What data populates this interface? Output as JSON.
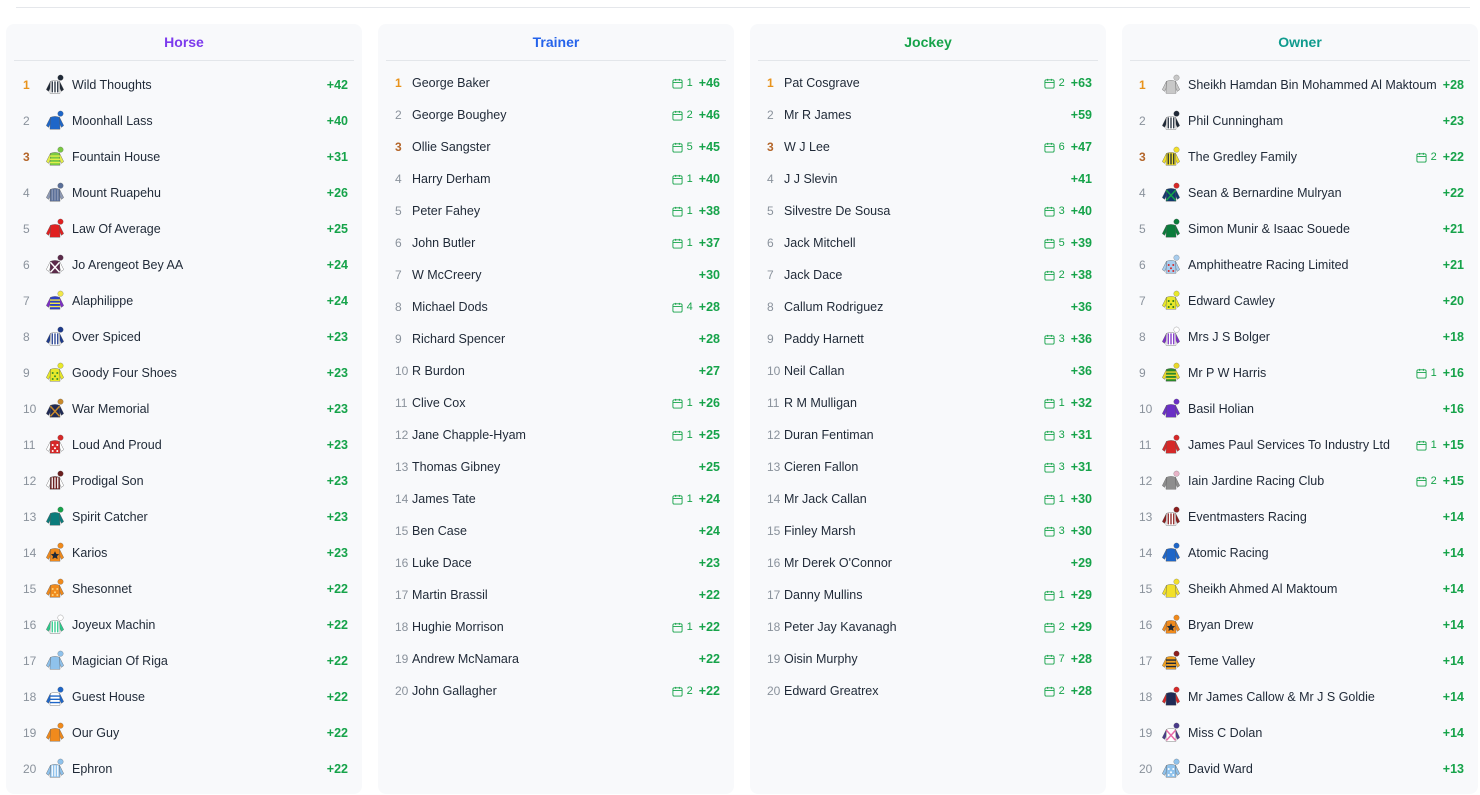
{
  "colors": {
    "horse": "#7c3aed",
    "trainer": "#2563eb",
    "jockey": "#16a34a",
    "owner": "#0f9b8e",
    "positive": "#16a34a",
    "gold": "#e8931c",
    "bronze": "#b4662a"
  },
  "panels": [
    {
      "title": "Horse",
      "rows": [
        {
          "rank": "1",
          "name": "Wild Thoughts",
          "cal": "",
          "score": "+42",
          "silk": {
            "body": "#ffffff",
            "sleeve": "#1f2937",
            "cap": "#1f2937",
            "pattern": "stripes",
            "pc": "#1f2937"
          }
        },
        {
          "rank": "2",
          "name": "Moonhall Lass",
          "cal": "",
          "score": "+40",
          "silk": {
            "body": "#1e66c8",
            "sleeve": "#1e66c8",
            "cap": "#1e66c8",
            "pattern": "none",
            "pc": "#ffffff"
          }
        },
        {
          "rank": "3",
          "name": "Fountain House",
          "cal": "",
          "score": "+31",
          "silk": {
            "body": "#7ac943",
            "sleeve": "#e2ef4a",
            "cap": "#7ac943",
            "pattern": "hoops",
            "pc": "#e2ef4a"
          }
        },
        {
          "rank": "4",
          "name": "Mount Ruapehu",
          "cal": "",
          "score": "+26",
          "silk": {
            "body": "#5a6f99",
            "sleeve": "#8e9ab5",
            "cap": "#5a6f99",
            "pattern": "stripes",
            "pc": "#8e9ab5"
          }
        },
        {
          "rank": "5",
          "name": "Law Of Average",
          "cal": "",
          "score": "+25",
          "silk": {
            "body": "#e02020",
            "sleeve": "#e02020",
            "cap": "#e02020",
            "pattern": "none",
            "pc": "#ffffff"
          }
        },
        {
          "rank": "6",
          "name": "Jo Arengeot Bey AA",
          "cal": "",
          "score": "+24",
          "silk": {
            "body": "#5b2a4a",
            "sleeve": "#ffffff",
            "cap": "#5b2a4a",
            "pattern": "cross",
            "pc": "#ffffff"
          }
        },
        {
          "rank": "7",
          "name": "Alaphilippe",
          "cal": "",
          "score": "+24",
          "silk": {
            "body": "#2b3ec7",
            "sleeve": "#7b2fc5",
            "cap": "#f2e84a",
            "pattern": "hoops",
            "pc": "#f2e84a"
          }
        },
        {
          "rank": "8",
          "name": "Over Spiced",
          "cal": "",
          "score": "+23",
          "silk": {
            "body": "#ffffff",
            "sleeve": "#1d3a8c",
            "cap": "#1d3a8c",
            "pattern": "stripes",
            "pc": "#1d3a8c"
          }
        },
        {
          "rank": "9",
          "name": "Goody Four Shoes",
          "cal": "",
          "score": "+23",
          "silk": {
            "body": "#e8e82a",
            "sleeve": "#e8e82a",
            "cap": "#e8e82a",
            "pattern": "dots",
            "pc": "#3a8f2a"
          }
        },
        {
          "rank": "10",
          "name": "War Memorial",
          "cal": "",
          "score": "+23",
          "silk": {
            "body": "#1f2a55",
            "sleeve": "#1f2a55",
            "cap": "#c98a2b",
            "pattern": "cross",
            "pc": "#c98a2b"
          }
        },
        {
          "rank": "11",
          "name": "Loud And Proud",
          "cal": "",
          "score": "+23",
          "silk": {
            "body": "#d62828",
            "sleeve": "#ffffff",
            "cap": "#d62828",
            "pattern": "dots",
            "pc": "#ffffff"
          }
        },
        {
          "rank": "12",
          "name": "Prodigal Son",
          "cal": "",
          "score": "+23",
          "silk": {
            "body": "#6b1f1f",
            "sleeve": "#ffffff",
            "cap": "#6b1f1f",
            "pattern": "stripes",
            "pc": "#ffffff"
          }
        },
        {
          "rank": "13",
          "name": "Spirit Catcher",
          "cal": "",
          "score": "+23",
          "silk": {
            "body": "#0b7b7b",
            "sleeve": "#0b7b7b",
            "cap": "#16a34a",
            "pattern": "none",
            "pc": "#ffffff"
          }
        },
        {
          "rank": "14",
          "name": "Karios",
          "cal": "",
          "score": "+23",
          "silk": {
            "body": "#f08a1c",
            "sleeve": "#f08a1c",
            "cap": "#f08a1c",
            "pattern": "star",
            "pc": "#1f2937"
          }
        },
        {
          "rank": "15",
          "name": "Shesonnet",
          "cal": "",
          "score": "+22",
          "silk": {
            "body": "#f08a1c",
            "sleeve": "#f08a1c",
            "cap": "#f08a1c",
            "pattern": "dots",
            "pc": "#ffd27a"
          }
        },
        {
          "rank": "16",
          "name": "Joyeux Machin",
          "cal": "",
          "score": "+22",
          "silk": {
            "body": "#ffffff",
            "sleeve": "#2cc98a",
            "cap": "#ffffff",
            "pattern": "stripes",
            "pc": "#2cc98a"
          }
        },
        {
          "rank": "17",
          "name": "Magician Of Riga",
          "cal": "",
          "score": "+22",
          "silk": {
            "body": "#8fc2ec",
            "sleeve": "#8fc2ec",
            "cap": "#8fc2ec",
            "pattern": "none",
            "pc": "#ffffff"
          }
        },
        {
          "rank": "18",
          "name": "Guest House",
          "cal": "",
          "score": "+22",
          "silk": {
            "body": "#ffffff",
            "sleeve": "#1e66c8",
            "cap": "#1e66c8",
            "pattern": "hoops",
            "pc": "#1e66c8"
          }
        },
        {
          "rank": "19",
          "name": "Our Guy",
          "cal": "",
          "score": "+22",
          "silk": {
            "body": "#f08a1c",
            "sleeve": "#f08a1c",
            "cap": "#f08a1c",
            "pattern": "none",
            "pc": "#ffffff"
          }
        },
        {
          "rank": "20",
          "name": "Ephron",
          "cal": "",
          "score": "+22",
          "silk": {
            "body": "#8fc2ec",
            "sleeve": "#8fc2ec",
            "cap": "#8fc2ec",
            "pattern": "stripes",
            "pc": "#ffffff"
          }
        }
      ]
    },
    {
      "title": "Trainer",
      "rows": [
        {
          "rank": "1",
          "name": "George Baker",
          "cal": "1",
          "score": "+46"
        },
        {
          "rank": "2",
          "name": "George Boughey",
          "cal": "2",
          "score": "+46"
        },
        {
          "rank": "3",
          "name": "Ollie Sangster",
          "cal": "5",
          "score": "+45"
        },
        {
          "rank": "4",
          "name": "Harry Derham",
          "cal": "1",
          "score": "+40"
        },
        {
          "rank": "5",
          "name": "Peter Fahey",
          "cal": "1",
          "score": "+38"
        },
        {
          "rank": "6",
          "name": "John Butler",
          "cal": "1",
          "score": "+37"
        },
        {
          "rank": "7",
          "name": "W McCreery",
          "cal": "",
          "score": "+30"
        },
        {
          "rank": "8",
          "name": "Michael Dods",
          "cal": "4",
          "score": "+28"
        },
        {
          "rank": "9",
          "name": "Richard Spencer",
          "cal": "",
          "score": "+28"
        },
        {
          "rank": "10",
          "name": "R Burdon",
          "cal": "",
          "score": "+27"
        },
        {
          "rank": "11",
          "name": "Clive Cox",
          "cal": "1",
          "score": "+26"
        },
        {
          "rank": "12",
          "name": "Jane Chapple-Hyam",
          "cal": "1",
          "score": "+25"
        },
        {
          "rank": "13",
          "name": "Thomas Gibney",
          "cal": "",
          "score": "+25"
        },
        {
          "rank": "14",
          "name": "James Tate",
          "cal": "1",
          "score": "+24"
        },
        {
          "rank": "15",
          "name": "Ben Case",
          "cal": "",
          "score": "+24"
        },
        {
          "rank": "16",
          "name": "Luke Dace",
          "cal": "",
          "score": "+23"
        },
        {
          "rank": "17",
          "name": "Martin Brassil",
          "cal": "",
          "score": "+22"
        },
        {
          "rank": "18",
          "name": "Hughie Morrison",
          "cal": "1",
          "score": "+22"
        },
        {
          "rank": "19",
          "name": "Andrew McNamara",
          "cal": "",
          "score": "+22"
        },
        {
          "rank": "20",
          "name": "John Gallagher",
          "cal": "2",
          "score": "+22"
        }
      ]
    },
    {
      "title": "Jockey",
      "rows": [
        {
          "rank": "1",
          "name": "Pat Cosgrave",
          "cal": "2",
          "score": "+63"
        },
        {
          "rank": "2",
          "name": "Mr R James",
          "cal": "",
          "score": "+59"
        },
        {
          "rank": "3",
          "name": "W J Lee",
          "cal": "6",
          "score": "+47"
        },
        {
          "rank": "4",
          "name": "J J Slevin",
          "cal": "",
          "score": "+41"
        },
        {
          "rank": "5",
          "name": "Silvestre De Sousa",
          "cal": "3",
          "score": "+40"
        },
        {
          "rank": "6",
          "name": "Jack Mitchell",
          "cal": "5",
          "score": "+39"
        },
        {
          "rank": "7",
          "name": "Jack Dace",
          "cal": "2",
          "score": "+38"
        },
        {
          "rank": "8",
          "name": "Callum Rodriguez",
          "cal": "",
          "score": "+36"
        },
        {
          "rank": "9",
          "name": "Paddy Harnett",
          "cal": "3",
          "score": "+36"
        },
        {
          "rank": "10",
          "name": "Neil Callan",
          "cal": "",
          "score": "+36"
        },
        {
          "rank": "11",
          "name": "R M Mulligan",
          "cal": "1",
          "score": "+32"
        },
        {
          "rank": "12",
          "name": "Duran Fentiman",
          "cal": "3",
          "score": "+31"
        },
        {
          "rank": "13",
          "name": "Cieren Fallon",
          "cal": "3",
          "score": "+31"
        },
        {
          "rank": "14",
          "name": "Mr Jack Callan",
          "cal": "1",
          "score": "+30"
        },
        {
          "rank": "15",
          "name": "Finley Marsh",
          "cal": "3",
          "score": "+30"
        },
        {
          "rank": "16",
          "name": "Mr Derek O'Connor",
          "cal": "",
          "score": "+29"
        },
        {
          "rank": "17",
          "name": "Danny Mullins",
          "cal": "1",
          "score": "+29"
        },
        {
          "rank": "18",
          "name": "Peter Jay Kavanagh",
          "cal": "2",
          "score": "+29"
        },
        {
          "rank": "19",
          "name": "Oisin Murphy",
          "cal": "7",
          "score": "+28"
        },
        {
          "rank": "20",
          "name": "Edward Greatrex",
          "cal": "2",
          "score": "+28"
        }
      ]
    },
    {
      "title": "Owner",
      "rows": [
        {
          "rank": "1",
          "name": "Sheikh Hamdan Bin Mohammed Al Maktoum",
          "cal": "",
          "score": "+28",
          "silk": {
            "body": "#c8c8c8",
            "sleeve": "#c8c8c8",
            "cap": "#c8c8c8",
            "pattern": "none",
            "pc": "#ffffff"
          }
        },
        {
          "rank": "2",
          "name": "Phil Cunningham",
          "cal": "",
          "score": "+23",
          "silk": {
            "body": "#ffffff",
            "sleeve": "#1f2937",
            "cap": "#1f2937",
            "pattern": "stripes",
            "pc": "#1f2937"
          }
        },
        {
          "rank": "3",
          "name": "The Gredley Family",
          "cal": "2",
          "score": "+22",
          "silk": {
            "body": "#f2e02a",
            "sleeve": "#f2e02a",
            "cap": "#f2e02a",
            "pattern": "stripes",
            "pc": "#1f2937"
          }
        },
        {
          "rank": "4",
          "name": "Sean & Bernardine Mulryan",
          "cal": "",
          "score": "+22",
          "silk": {
            "body": "#12396e",
            "sleeve": "#12396e",
            "cap": "#d62828",
            "pattern": "cross",
            "pc": "#16a34a"
          }
        },
        {
          "rank": "5",
          "name": "Simon Munir & Isaac Souede",
          "cal": "",
          "score": "+21",
          "silk": {
            "body": "#0b7b3b",
            "sleeve": "#0b7b3b",
            "cap": "#0b7b3b",
            "pattern": "none",
            "pc": "#ffffff"
          }
        },
        {
          "rank": "6",
          "name": "Amphitheatre Racing Limited",
          "cal": "",
          "score": "+21",
          "silk": {
            "body": "#a8cdee",
            "sleeve": "#a8cdee",
            "cap": "#a8cdee",
            "pattern": "dots",
            "pc": "#d62828"
          }
        },
        {
          "rank": "7",
          "name": "Edward Cawley",
          "cal": "",
          "score": "+20",
          "silk": {
            "body": "#e8e82a",
            "sleeve": "#e8e82a",
            "cap": "#e8e82a",
            "pattern": "dots",
            "pc": "#2a7a1f"
          }
        },
        {
          "rank": "8",
          "name": "Mrs J S Bolger",
          "cal": "",
          "score": "+18",
          "silk": {
            "body": "#ffffff",
            "sleeve": "#7b2fc5",
            "cap": "#ffffff",
            "pattern": "stripes",
            "pc": "#7b2fc5"
          }
        },
        {
          "rank": "9",
          "name": "Mr P W Harris",
          "cal": "1",
          "score": "+16",
          "silk": {
            "body": "#2a8a2a",
            "sleeve": "#e8d82a",
            "cap": "#e8d82a",
            "pattern": "hoops",
            "pc": "#e8d82a"
          }
        },
        {
          "rank": "10",
          "name": "Basil Holian",
          "cal": "",
          "score": "+16",
          "silk": {
            "body": "#6a2fc5",
            "sleeve": "#6a2fc5",
            "cap": "#6a2fc5",
            "pattern": "none",
            "pc": "#ffffff"
          }
        },
        {
          "rank": "11",
          "name": "James Paul Services To Industry Ltd",
          "cal": "1",
          "score": "+15",
          "silk": {
            "body": "#d62828",
            "sleeve": "#d62828",
            "cap": "#d62828",
            "pattern": "none",
            "pc": "#ffffff"
          }
        },
        {
          "rank": "12",
          "name": "Iain Jardine Racing Club",
          "cal": "2",
          "score": "+15",
          "silk": {
            "body": "#8e8e8e",
            "sleeve": "#8e8e8e",
            "cap": "#e8b4c8",
            "pattern": "none",
            "pc": "#ffffff"
          }
        },
        {
          "rank": "13",
          "name": "Eventmasters Racing",
          "cal": "",
          "score": "+14",
          "silk": {
            "body": "#ffffff",
            "sleeve": "#8b1e1e",
            "cap": "#8b1e1e",
            "pattern": "stripes",
            "pc": "#8b1e1e"
          }
        },
        {
          "rank": "14",
          "name": "Atomic Racing",
          "cal": "",
          "score": "+14",
          "silk": {
            "body": "#1e66c8",
            "sleeve": "#1e66c8",
            "cap": "#1e66c8",
            "pattern": "none",
            "pc": "#ffffff"
          }
        },
        {
          "rank": "15",
          "name": "Sheikh Ahmed Al Maktoum",
          "cal": "",
          "score": "+14",
          "silk": {
            "body": "#f2e02a",
            "sleeve": "#f2e02a",
            "cap": "#f2e02a",
            "pattern": "none",
            "pc": "#ffffff"
          }
        },
        {
          "rank": "16",
          "name": "Bryan Drew",
          "cal": "",
          "score": "+14",
          "silk": {
            "body": "#f08a1c",
            "sleeve": "#f08a1c",
            "cap": "#f08a1c",
            "pattern": "star",
            "pc": "#1f2937"
          }
        },
        {
          "rank": "17",
          "name": "Teme Valley",
          "cal": "",
          "score": "+14",
          "silk": {
            "body": "#f0a020",
            "sleeve": "#f0a020",
            "cap": "#8b1e1e",
            "pattern": "hoops",
            "pc": "#1f2937"
          }
        },
        {
          "rank": "18",
          "name": "Mr James Callow & Mr J S Goldie",
          "cal": "",
          "score": "+14",
          "silk": {
            "body": "#1f2a55",
            "sleeve": "#d62828",
            "cap": "#d62828",
            "pattern": "none",
            "pc": "#ffffff"
          }
        },
        {
          "rank": "19",
          "name": "Miss C Dolan",
          "cal": "",
          "score": "+14",
          "silk": {
            "body": "#ffffff",
            "sleeve": "#4a3a8a",
            "cap": "#4a3a8a",
            "pattern": "cross",
            "pc": "#e86aa8"
          }
        },
        {
          "rank": "20",
          "name": "David Ward",
          "cal": "",
          "score": "+13",
          "silk": {
            "body": "#8fc2ec",
            "sleeve": "#8fc2ec",
            "cap": "#8fc2ec",
            "pattern": "dots",
            "pc": "#ffffff"
          }
        }
      ]
    }
  ]
}
